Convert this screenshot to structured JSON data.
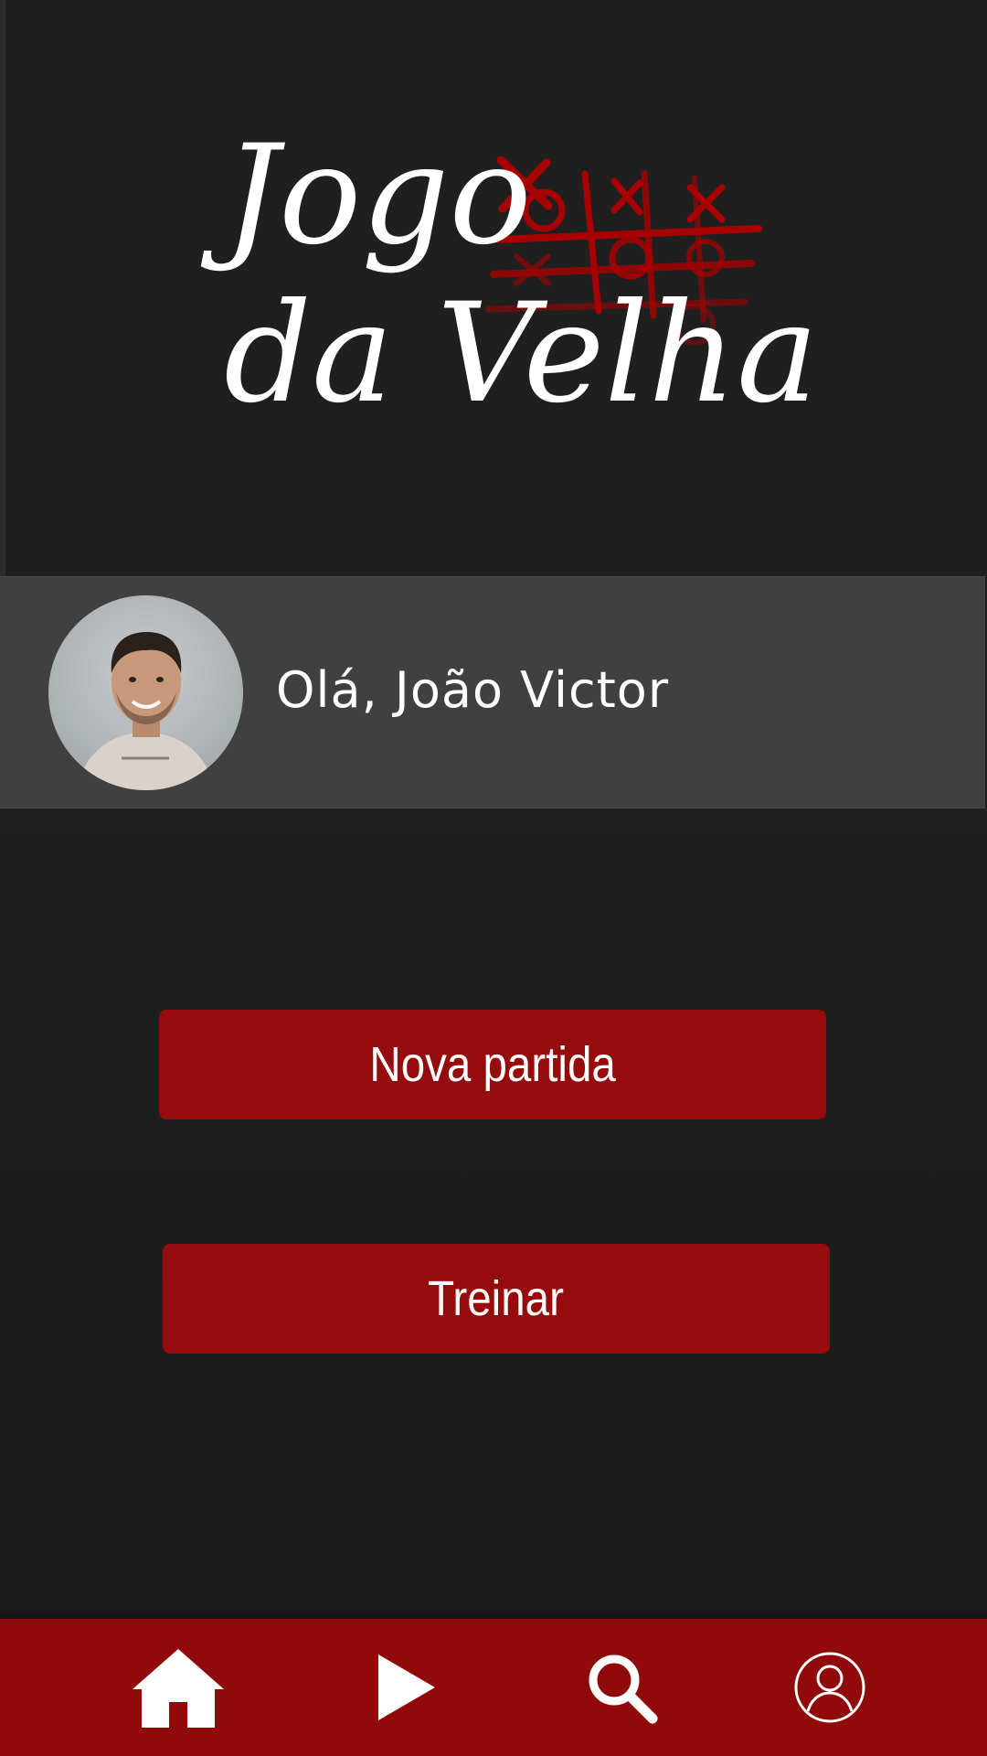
{
  "logo": {
    "line1": "Jogo",
    "line2": "da Velha",
    "accent_color": "#b00000"
  },
  "greeting": {
    "text": "Olá, João Victor",
    "avatar_alt": "profile photo"
  },
  "buttons": {
    "new_match": "Nova partida",
    "train": "Treinar"
  },
  "nav": {
    "items": [
      {
        "icon": "home-icon"
      },
      {
        "icon": "play-icon"
      },
      {
        "icon": "search-icon"
      },
      {
        "icon": "profile-icon"
      }
    ]
  },
  "colors": {
    "background": "#1e1e1f",
    "greeting_bar": "#404041",
    "button": "#960b0b",
    "nav_bar": "#910a0a"
  }
}
